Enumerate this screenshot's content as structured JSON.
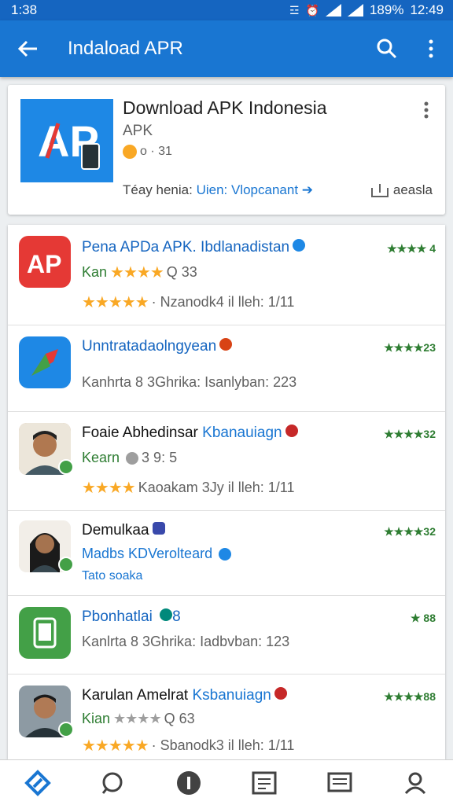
{
  "status_bar": {
    "time": "1:38",
    "battery": "189%",
    "clock": "12:49"
  },
  "app_bar": {
    "title": "Indaload APR"
  },
  "featured": {
    "title": "Download APK Indonesia",
    "subtitle": "APK",
    "meta": "o · 31",
    "tagline_prefix": "Téay henia: ",
    "tagline_link": "Uien: Vlopcanant",
    "share_label": "aeasla"
  },
  "list": [
    {
      "name": "Pena APDa APK. Ibdlanadistan",
      "line1_label": "Kan",
      "line1_extra": "Q 33",
      "line2": "· Nzanodk4 il lleh: 1/11",
      "rating": "★★★★ 4",
      "icon": "apk-red-icon"
    },
    {
      "name": "Unntratadaolngyean",
      "line1_label": "Kanhrta 8 3Ghrika: Isanlyban: 223",
      "rating": "★★★★23",
      "icon": "arrow-app-icon"
    },
    {
      "name_dark": "Foaie Abhedinsar ",
      "name_blue": "Kbanauiagn",
      "line1_label": "Kearn",
      "line1_extra": "3  9: 5",
      "line2": "Kaoakam 3Jy il lleh: 1/11",
      "rating": "★★★★32",
      "icon": "person-avatar"
    },
    {
      "name_dark": "Demulkaa",
      "line1_label": "Madbs KDVerolteard",
      "line2": "Tato soaka",
      "rating": "★★★★32",
      "icon": "woman-avatar"
    },
    {
      "name": "Pbonhatlai",
      "badge": "8",
      "line1_label": "Kanlrta 8 3Ghrika: Iadbvban: 123",
      "rating": "★ 88",
      "icon": "phone-app-icon"
    },
    {
      "name_dark": "Karulan  Amelrat ",
      "name_blue": "Ksbanuiagn",
      "line1_label": "Kian",
      "line1_extra": "Q 63",
      "line2": "· Sbanodk3 il lleh: 1/11",
      "rating": "★★★★88",
      "icon": "man-avatar"
    }
  ],
  "colors": {
    "primary": "#1976d2",
    "status": "#1565c0",
    "rating_green": "#2e7d32",
    "star": "#f9a825"
  }
}
